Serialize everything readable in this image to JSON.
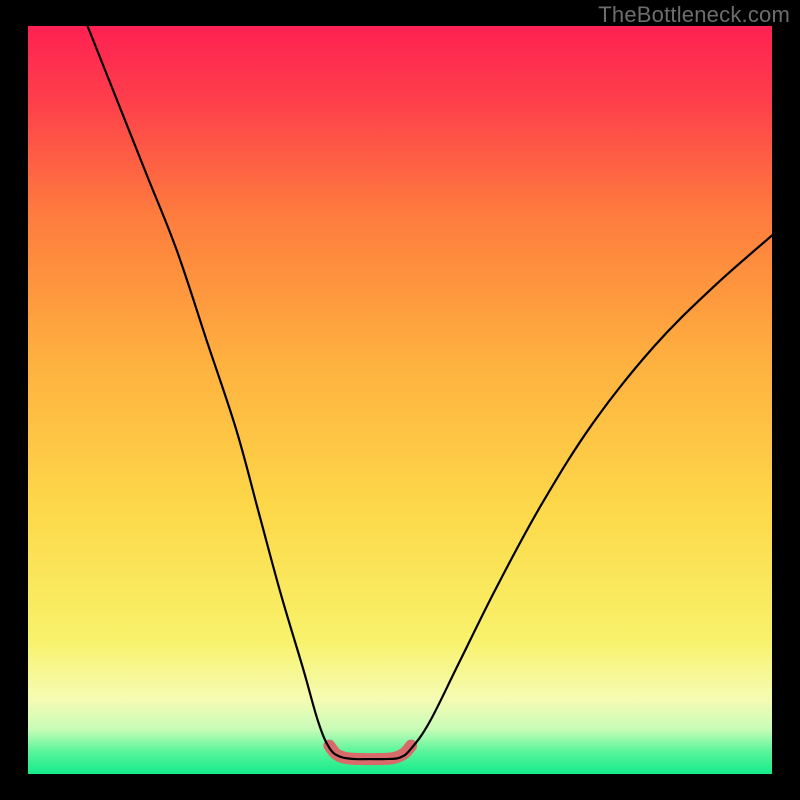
{
  "watermark": "TheBottleneck.com",
  "chart_data": {
    "type": "line",
    "title": "",
    "xlabel": "",
    "ylabel": "",
    "xlim": [
      0,
      100
    ],
    "ylim": [
      0,
      100
    ],
    "gradient_stops": [
      {
        "offset": 0,
        "color": "#14eb8a"
      },
      {
        "offset": 3,
        "color": "#5af59b"
      },
      {
        "offset": 6,
        "color": "#c8fcb7"
      },
      {
        "offset": 10,
        "color": "#f6fbb3"
      },
      {
        "offset": 18,
        "color": "#f8f26a"
      },
      {
        "offset": 35,
        "color": "#fdd94a"
      },
      {
        "offset": 55,
        "color": "#feb13f"
      },
      {
        "offset": 75,
        "color": "#fe7b3e"
      },
      {
        "offset": 90,
        "color": "#fe3f4b"
      },
      {
        "offset": 100,
        "color": "#ff2152"
      }
    ],
    "series": [
      {
        "name": "curve",
        "stroke": "#000000",
        "stroke_width": 2.2,
        "points": [
          {
            "x": 8,
            "y": 100
          },
          {
            "x": 12,
            "y": 90
          },
          {
            "x": 16,
            "y": 80
          },
          {
            "x": 20,
            "y": 70
          },
          {
            "x": 24,
            "y": 58
          },
          {
            "x": 28,
            "y": 46
          },
          {
            "x": 31,
            "y": 35
          },
          {
            "x": 34,
            "y": 24
          },
          {
            "x": 37,
            "y": 14
          },
          {
            "x": 39,
            "y": 7
          },
          {
            "x": 40.5,
            "y": 3.5
          },
          {
            "x": 42,
            "y": 2.3
          },
          {
            "x": 44,
            "y": 2.0
          },
          {
            "x": 46,
            "y": 2.0
          },
          {
            "x": 48,
            "y": 2.0
          },
          {
            "x": 50,
            "y": 2.2
          },
          {
            "x": 51.5,
            "y": 3.4
          },
          {
            "x": 54,
            "y": 7
          },
          {
            "x": 58,
            "y": 15
          },
          {
            "x": 63,
            "y": 25
          },
          {
            "x": 69,
            "y": 36
          },
          {
            "x": 76,
            "y": 47
          },
          {
            "x": 84,
            "y": 57
          },
          {
            "x": 92,
            "y": 65
          },
          {
            "x": 100,
            "y": 72
          }
        ]
      },
      {
        "name": "highlight",
        "stroke": "#d96a6a",
        "stroke_width": 12,
        "points": [
          {
            "x": 40.5,
            "y": 3.8
          },
          {
            "x": 41.5,
            "y": 2.6
          },
          {
            "x": 43,
            "y": 2.1
          },
          {
            "x": 45,
            "y": 2.0
          },
          {
            "x": 47,
            "y": 2.0
          },
          {
            "x": 49,
            "y": 2.1
          },
          {
            "x": 50.5,
            "y": 2.7
          },
          {
            "x": 51.5,
            "y": 3.8
          }
        ]
      }
    ]
  }
}
